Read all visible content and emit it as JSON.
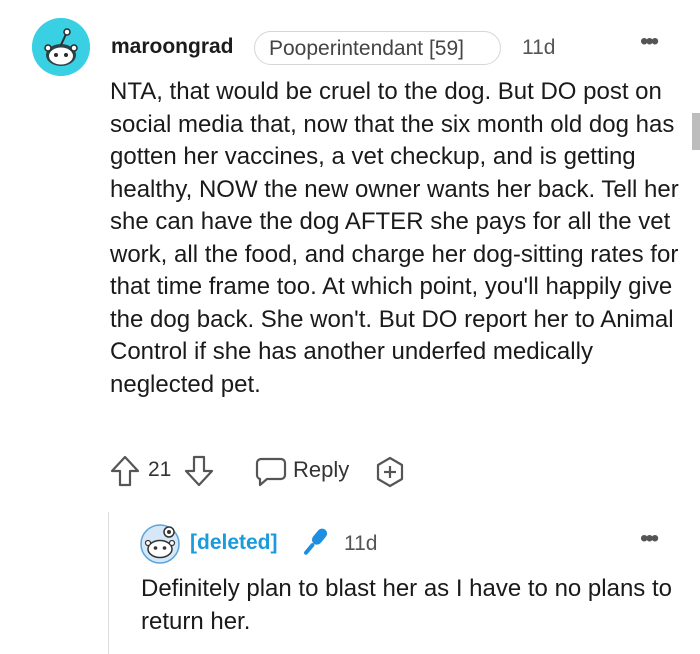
{
  "comment": {
    "username": "maroongrad",
    "flair": "Pooperintendant [59]",
    "time": "11d",
    "more": "•••",
    "body": "NTA, that would be cruel to the dog. But DO post on social media that, now that the six month old dog has gotten her vaccines, a vet checkup, and is getting healthy, NOW the new owner wants her back. Tell her she can have the dog AFTER she pays for all the vet work, all the food, and charge her dog-sitting rates for that time frame too. At which point, you'll happily give the dog back. She won't. But DO report her to Animal Control if she has another underfed medically neglected pet.",
    "votes": "21",
    "reply_label": "Reply",
    "avatar_color": "#39d0e3"
  },
  "reply": {
    "username": "[deleted]",
    "time": "11d",
    "more": "•••",
    "body": "Definitely plan to blast her as I have to no plans to return her.",
    "username_color": "#1a9bdc"
  }
}
